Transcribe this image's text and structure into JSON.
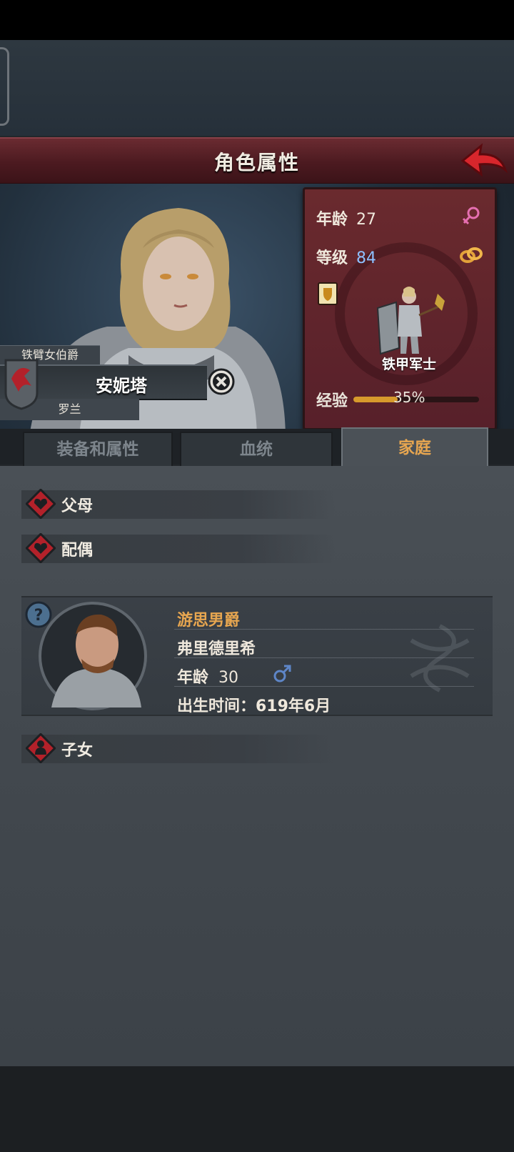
{
  "header": {
    "title": "角色属性"
  },
  "character": {
    "title": "铁臂女伯爵",
    "name": "安妮塔",
    "house": "罗兰",
    "age_label": "年龄",
    "age": "27",
    "level_label": "等级",
    "level": "84",
    "class_name": "铁甲军士",
    "exp_label": "经验",
    "exp_percent": "35%",
    "exp_fraction": 0.35
  },
  "tabs": [
    {
      "label": "装备和属性",
      "active": false
    },
    {
      "label": "血统",
      "active": false
    },
    {
      "label": "家庭",
      "active": true
    }
  ],
  "family": {
    "parents_label": "父母",
    "spouse_label": "配偶",
    "children_label": "子女",
    "spouse": {
      "title": "游思男爵",
      "name": "弗里德里希",
      "age_label": "年龄",
      "age": "30",
      "birth": "出生时间：619年6月"
    }
  },
  "colors": {
    "accent": "#e7a650",
    "level_blue": "#8ec0ff",
    "title_bar": "#4c1a20",
    "stats_panel": "#5e2428"
  }
}
